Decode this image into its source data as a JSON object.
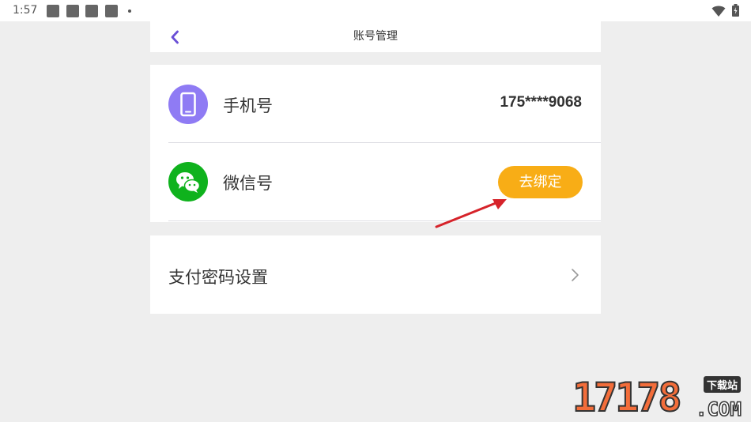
{
  "status_bar": {
    "time": "1:57",
    "notification_icons": [
      "app-icon",
      "app-icon",
      "app-icon",
      "app-icon"
    ],
    "wifi_icon": "wifi-icon",
    "battery_icon": "battery-icon"
  },
  "nav": {
    "title": "账号管理",
    "back_icon": "chevron-left-icon"
  },
  "accounts": {
    "phone": {
      "label": "手机号",
      "value": "175****9068",
      "icon": "mobile-phone-icon",
      "icon_color": "#8f7bf4"
    },
    "wechat": {
      "label": "微信号",
      "button_label": "去绑定",
      "icon": "wechat-icon",
      "icon_color": "#0fb21d",
      "button_color": "#f8ad16"
    }
  },
  "settings": {
    "pay_password_label": "支付密码设置",
    "chevron_icon": "chevron-right-icon"
  },
  "accent_color": "#6a4fd6",
  "watermark": {
    "digits": "17178",
    "tag": "下载站",
    "com": ".COM"
  }
}
